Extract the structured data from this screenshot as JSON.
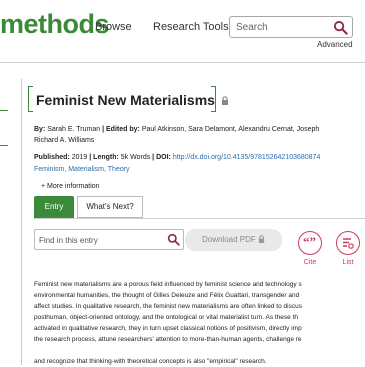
{
  "header": {
    "logo_text": "methods",
    "nav": [
      "Browse",
      "Research Tools"
    ],
    "search_placeholder": "Search",
    "advanced_label": "Advanced"
  },
  "entry": {
    "title": "Feminist New Materialisms",
    "by_label": "By:",
    "author": "Sarah E. Truman",
    "edited_label": "| Edited by:",
    "editors_line1": "Paul Atkinson, Sara Delamont, Alexandru Cernat, Joseph",
    "editors_line2": "Richard A. Williams",
    "published_label": "Published:",
    "published_value": "2019",
    "length_label": "| Length:",
    "length_value": "5k Words",
    "doi_label": "| DOI:",
    "doi_value": "http://dx.doi.org/10.4135/978152642103680874",
    "keywords": "Feminism, Materialism, Theory",
    "more_info": "+ More information"
  },
  "tabs": [
    {
      "label": "Entry",
      "active": true
    },
    {
      "label": "What's Next?",
      "active": false
    }
  ],
  "tools": {
    "find_placeholder": "Find in this entry",
    "download_pdf": "Download PDF",
    "cite_label": "Cite",
    "list_label": "List"
  },
  "body_lines": [
    "Feminist new materialisms are a porous field influenced by feminist science and technology s",
    "environmental humanities, the thought of Gilles Deleuze and Félix Guattari, transgender and",
    "affect studies. In qualitative research, the feminist new materialisms are often linked to discus",
    "posthuman, object-oriented ontology, and the ontological or vital materialist turn. As these th",
    "activated in qualitative research, they in turn upset classical notions of positivism, directly imp",
    "the research process, attune researchers' attention to more-than-human agents, challenge re",
    "and recognize that thinking-with theoretical concepts is also \"empirical\" research."
  ],
  "colors": {
    "brand_green": "#3a8a3a",
    "accent_magenta": "#c83b5e",
    "link_blue": "#2b6db0"
  }
}
